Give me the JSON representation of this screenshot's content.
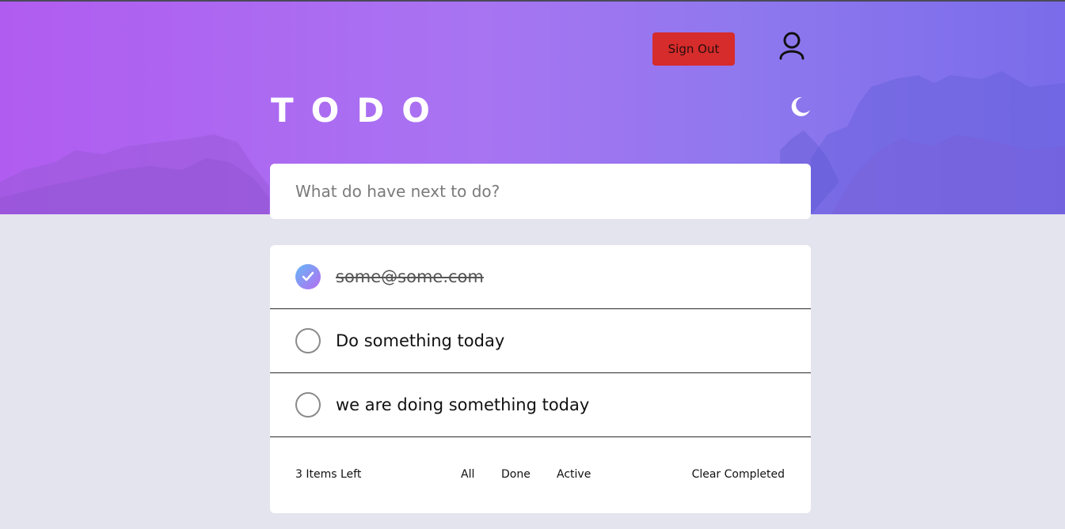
{
  "header": {
    "title": "TODO",
    "sign_out_label": "Sign Out",
    "user_icon": "user-icon",
    "theme_icon": "moon-icon"
  },
  "new_todo": {
    "placeholder": "What do have next to do?",
    "value": ""
  },
  "todos": [
    {
      "text": "some@some.com",
      "completed": true
    },
    {
      "text": "Do something today",
      "completed": false
    },
    {
      "text": "we are doing something today",
      "completed": false
    }
  ],
  "footer": {
    "items_left": "3 Items Left",
    "filters": [
      "All",
      "Done",
      "Active"
    ],
    "clear_label": "Clear Completed"
  },
  "colors": {
    "accent_gradient_start": "#b15cf0",
    "accent_gradient_end": "#7a6cea",
    "sign_out_bg": "#d62c2c",
    "check_gradient_start": "#63b7f7",
    "check_gradient_end": "#b76cf1",
    "page_bg": "#e4e4ef"
  }
}
